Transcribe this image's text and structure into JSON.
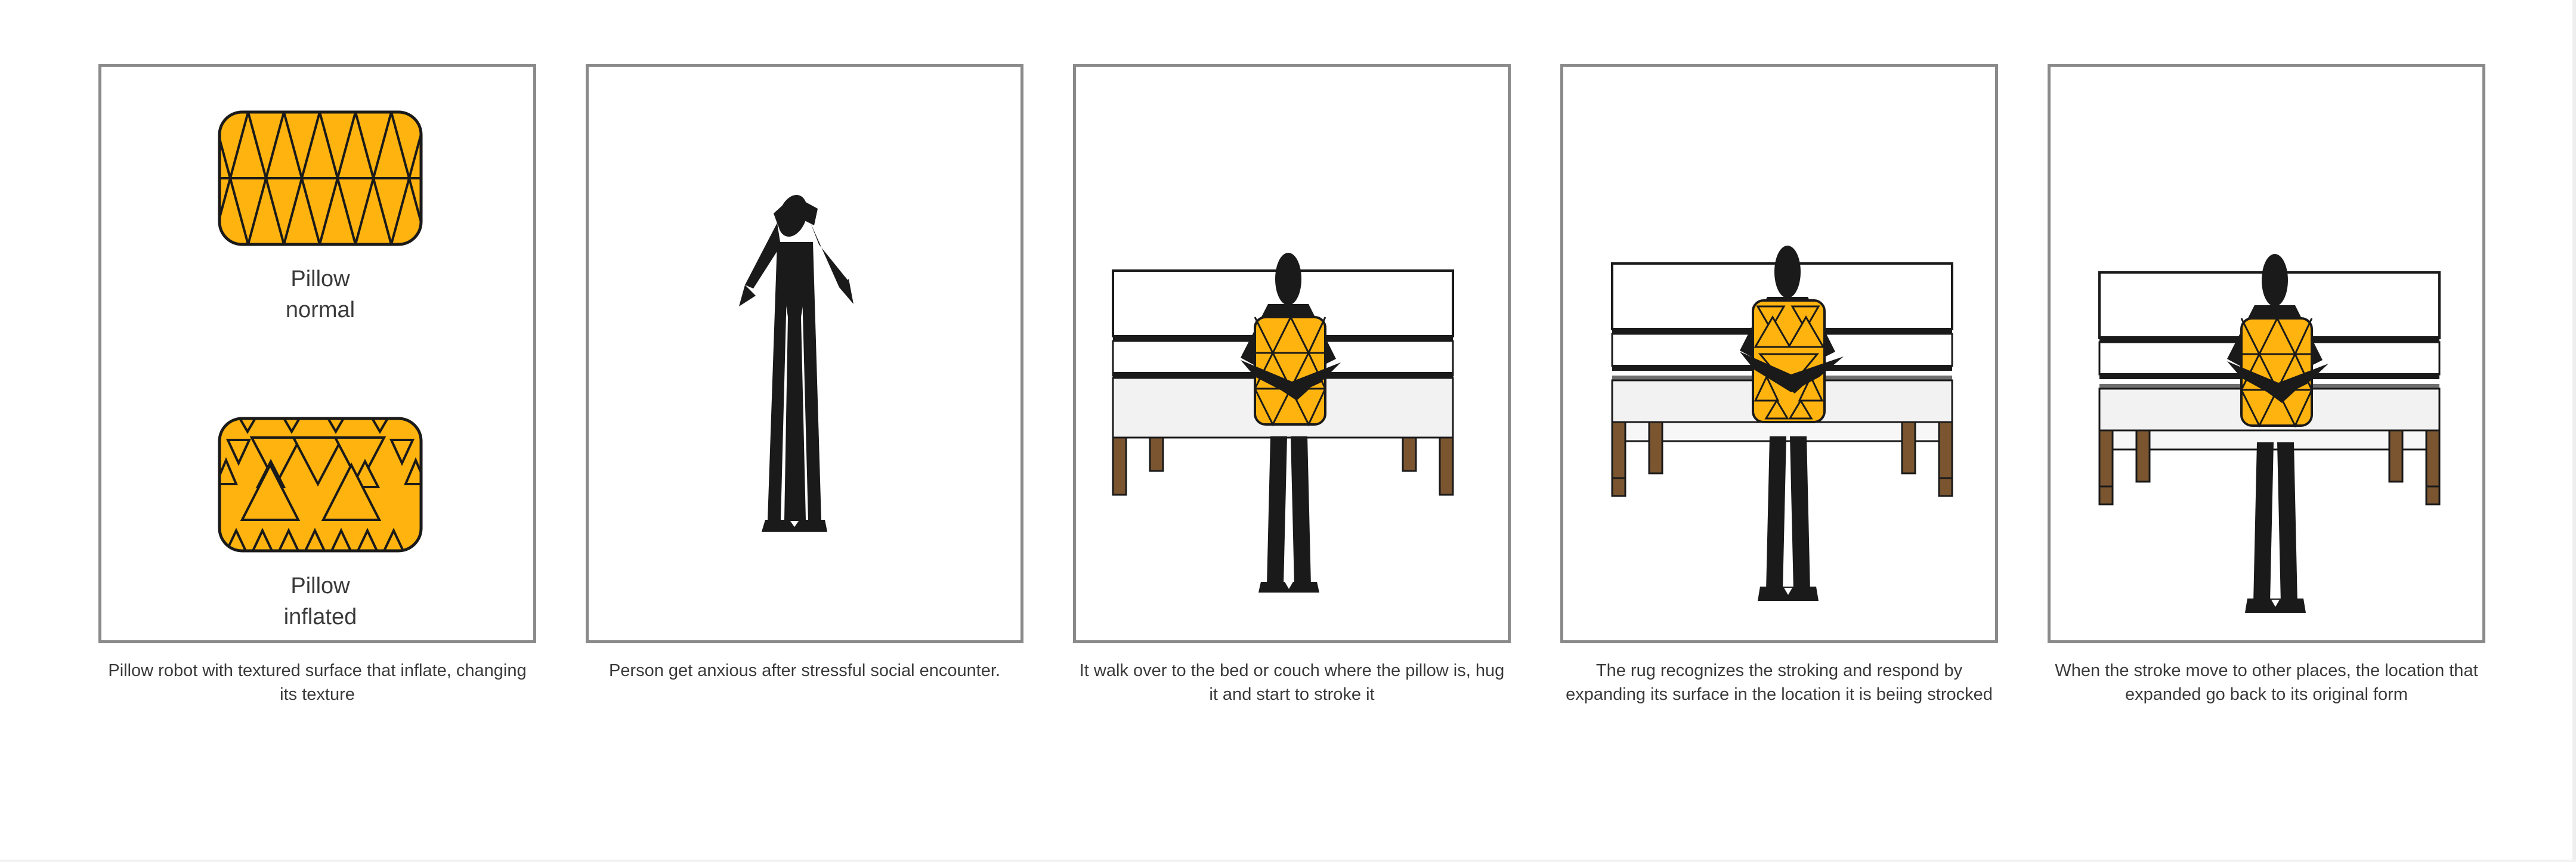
{
  "panels": [
    {
      "caption": "Pillow robot with textured surface that inflate, changing its texture",
      "labels": {
        "normal_line1": "Pillow",
        "normal_line2": "normal",
        "inflated_line1": "Pillow",
        "inflated_line2": "inflated"
      }
    },
    {
      "caption": "Person get anxious after stressful social encounter."
    },
    {
      "caption": "It walk over to the bed or couch where the pillow is, hug it and start to stroke it"
    },
    {
      "caption": "The rug recognizes the stroking and respond by expanding its surface in the location it is beiing strocked"
    },
    {
      "caption": "When the stroke move to other places, the location that expanded go back to its original form"
    }
  ],
  "colors": {
    "pillow": "#FFB30F",
    "figure": "#1a1a1a",
    "frame_border": "#8a8a8a",
    "bed_legs": "#7a5530"
  }
}
